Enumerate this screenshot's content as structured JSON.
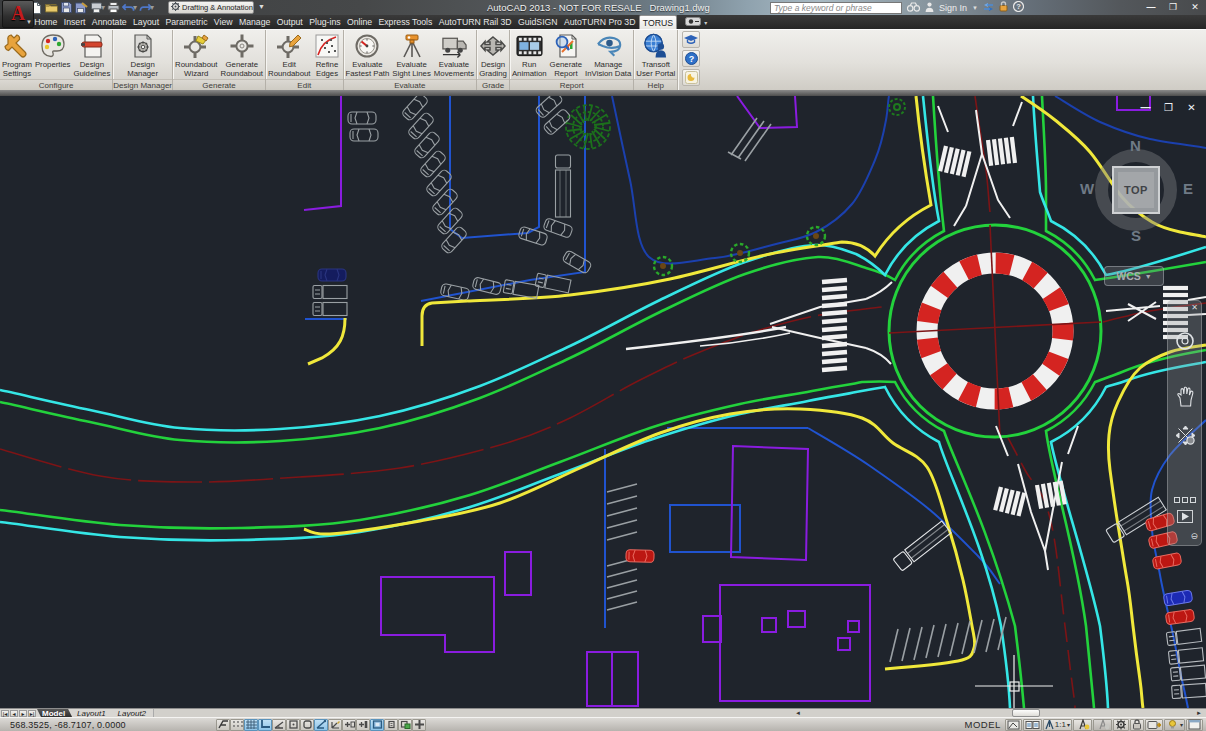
{
  "titlebar": {
    "app_button": {
      "icon": "autocad-logo",
      "letter": "A"
    },
    "quick_access": [
      {
        "name": "qnew",
        "icon": "file-new"
      },
      {
        "name": "open",
        "icon": "folder-open"
      },
      {
        "name": "save",
        "icon": "save"
      },
      {
        "name": "save-as",
        "icon": "save-as"
      },
      {
        "name": "plot-preview",
        "icon": "plot"
      },
      {
        "name": "print",
        "icon": "printer"
      },
      {
        "name": "undo",
        "icon": "undo"
      },
      {
        "name": "redo",
        "icon": "redo"
      }
    ],
    "workspace_selector": {
      "label": "Drafting & Annotation",
      "icon": "gear-icon"
    },
    "title": "AutoCAD 2013 - NOT FOR RESALE",
    "document": "Drawing1.dwg",
    "search": {
      "placeholder": "Type a keyword or phrase",
      "icon": "binoculars-icon"
    },
    "signin": {
      "label": "Sign In",
      "icon": "person-icon"
    },
    "comm_icons": [
      "exchange-icon",
      "lock-icon",
      "help-icon"
    ],
    "window_buttons": [
      "minimize",
      "maximize",
      "close"
    ]
  },
  "ribbon_tabs": [
    {
      "label": "Home",
      "active": false
    },
    {
      "label": "Insert",
      "active": false
    },
    {
      "label": "Annotate",
      "active": false
    },
    {
      "label": "Layout",
      "active": false
    },
    {
      "label": "Parametric",
      "active": false
    },
    {
      "label": "View",
      "active": false
    },
    {
      "label": "Manage",
      "active": false
    },
    {
      "label": "Output",
      "active": false
    },
    {
      "label": "Plug-ins",
      "active": false
    },
    {
      "label": "Online",
      "active": false
    },
    {
      "label": "Express Tools",
      "active": false
    },
    {
      "label": "AutoTURN Rail 3D",
      "active": false
    },
    {
      "label": "GuidSIGN",
      "active": false
    },
    {
      "label": "AutoTURN Pro 3D",
      "active": false
    },
    {
      "label": "TORUS",
      "active": true
    }
  ],
  "ribbon_groups": [
    {
      "label": "Configure",
      "items": [
        {
          "label": "Program Settings",
          "lines": [
            "Program",
            "Settings"
          ],
          "icon": "wrench"
        },
        {
          "label": "Properties",
          "lines": [
            "Properties"
          ],
          "icon": "palette"
        },
        {
          "label": "Design Guidelines",
          "lines": [
            "Design",
            "Guidelines"
          ],
          "icon": "guidelines"
        }
      ]
    },
    {
      "label": "Design Manager",
      "items": [
        {
          "label": "Design Manager",
          "lines": [
            "Design",
            "Manager"
          ],
          "icon": "design-manager"
        }
      ]
    },
    {
      "label": "Generate",
      "items": [
        {
          "label": "Roundabout Wizard",
          "lines": [
            "Roundabout",
            "Wizard"
          ],
          "icon": "roundabout-wizard"
        },
        {
          "label": "Generate Roundabout",
          "lines": [
            "Generate",
            "Roundabout"
          ],
          "icon": "roundabout"
        }
      ]
    },
    {
      "label": "Edit",
      "items": [
        {
          "label": "Edit Roundabout",
          "lines": [
            "Edit",
            "Roundabout"
          ],
          "icon": "edit-roundabout"
        },
        {
          "label": "Refine Edges",
          "lines": [
            "Refine",
            "Edges"
          ],
          "icon": "refine-edges"
        }
      ]
    },
    {
      "label": "Evaluate",
      "items": [
        {
          "label": "Evaluate Fastest Path",
          "lines": [
            "Evaluate",
            "Fastest Path"
          ],
          "icon": "gauge"
        },
        {
          "label": "Evaluate Sight Lines",
          "lines": [
            "Evaluate",
            "Sight Lines"
          ],
          "icon": "tripod"
        },
        {
          "label": "Evaluate Movements",
          "lines": [
            "Evaluate",
            "Movements"
          ],
          "icon": "truck"
        }
      ]
    },
    {
      "label": "Grade",
      "items": [
        {
          "label": "Design Grading",
          "lines": [
            "Design",
            "Grading"
          ],
          "icon": "grading"
        }
      ]
    },
    {
      "label": "Report",
      "items": [
        {
          "label": "Run Animation",
          "lines": [
            "Run",
            "Animation"
          ],
          "icon": "film"
        },
        {
          "label": "Generate Report",
          "lines": [
            "Generate",
            "Report"
          ],
          "icon": "report"
        },
        {
          "label": "Manage InVision Data",
          "lines": [
            "Manage",
            "InVision Data"
          ],
          "icon": "invision"
        }
      ]
    },
    {
      "label": "Help",
      "items": [
        {
          "label": "Transoft User Portal",
          "lines": [
            "Transoft",
            "User Portal"
          ],
          "icon": "portal"
        }
      ]
    }
  ],
  "ribbon_side_buttons": [
    "academic-icon",
    "help-circle-icon",
    "moon-icon"
  ],
  "canvas": {
    "doc_window_buttons": [
      "minimize",
      "restore",
      "close"
    ],
    "viewcube": {
      "north": "N",
      "south": "S",
      "east": "E",
      "west": "W",
      "top": "TOP"
    },
    "wcs": {
      "label": "WCS"
    },
    "navbar_icons": [
      "close-icon",
      "wheel-icon",
      "pan-hand-icon",
      "zoom-pan-icon",
      "squares-icon",
      "play-icon",
      "minus-circle-icon"
    ]
  },
  "layout_bar": {
    "nav_icons": [
      "first",
      "prev",
      "next",
      "last"
    ],
    "tabs": [
      {
        "label": "Model",
        "active": true
      },
      {
        "label": "Layout1",
        "active": false
      },
      {
        "label": "Layout2",
        "active": false
      }
    ],
    "scrollbar": {
      "left_arrow": "◄",
      "right_arrow": "►"
    }
  },
  "statusbar": {
    "coordinates": "568.3525,  -68.7107, 0.0000",
    "toggles": [
      {
        "name": "infer-constraints",
        "on": false
      },
      {
        "name": "snap-mode",
        "on": false
      },
      {
        "name": "grid-display",
        "on": true
      },
      {
        "name": "ortho-mode",
        "on": true
      },
      {
        "name": "polar-tracking",
        "on": false
      },
      {
        "name": "object-snap",
        "on": false
      },
      {
        "name": "3d-object-snap",
        "on": false
      },
      {
        "name": "object-snap-tracking",
        "on": true
      },
      {
        "name": "dynamic-ucs",
        "on": false
      },
      {
        "name": "dynamic-input",
        "on": false
      },
      {
        "name": "show-lineweight",
        "on": false
      },
      {
        "name": "show-transparency",
        "on": true
      },
      {
        "name": "quick-properties",
        "on": false
      },
      {
        "name": "selection-cycling",
        "on": false
      },
      {
        "name": "annotation-monitor",
        "on": false
      }
    ],
    "model_label": "MODEL",
    "annotation_scale": "1:1",
    "right_buttons": [
      "model-space-icon",
      "quick-view-icon",
      "annotation-scale",
      "annotation-visibility-icon",
      "annotation-auto-icon",
      "workspace-gear-icon",
      "lock-icon",
      "status-tray-icon",
      "isolate-objects-icon",
      "clean-screen-icon"
    ]
  },
  "palette": {
    "canvas_bg": "#1f242c",
    "edge_green": "#23d23c",
    "edge_cyan": "#35e6e6",
    "curb_yellow": "#f0e83b",
    "boundary_blue": "#2053cf",
    "building_purple": "#8a1ce0",
    "apron_red": "#d42421",
    "centerline_red": "#7c1416",
    "marking_white": "#f2f2f2",
    "vehicle_gray": "#9aa0a4",
    "tree_green": "#1e7a1e",
    "toggle_active": "#8ec4e8"
  }
}
